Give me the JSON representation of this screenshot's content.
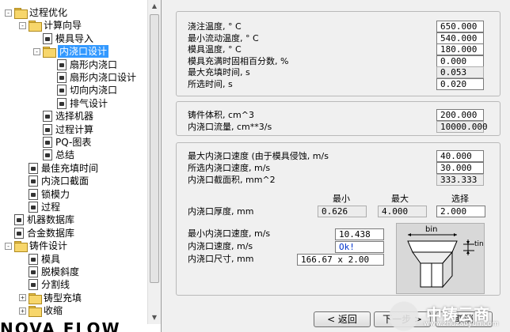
{
  "tree": {
    "items": [
      {
        "label": "过程优化",
        "level": 0,
        "type": "folder",
        "expander": "-"
      },
      {
        "label": "计算向导",
        "level": 1,
        "type": "folder",
        "expander": "-"
      },
      {
        "label": "模具导入",
        "level": 2,
        "type": "doc",
        "expander": ""
      },
      {
        "label": "内浇口设计",
        "level": 2,
        "type": "folder",
        "expander": "-",
        "selected": true
      },
      {
        "label": "扇形内浇口",
        "level": 3,
        "type": "doc",
        "expander": ""
      },
      {
        "label": "扇形内浇口设计",
        "level": 3,
        "type": "doc",
        "expander": ""
      },
      {
        "label": "切向内浇口",
        "level": 3,
        "type": "doc",
        "expander": ""
      },
      {
        "label": "排气设计",
        "level": 3,
        "type": "doc",
        "expander": ""
      },
      {
        "label": "选择机器",
        "level": 2,
        "type": "doc",
        "expander": ""
      },
      {
        "label": "过程计算",
        "level": 2,
        "type": "doc",
        "expander": ""
      },
      {
        "label": "PQ-图表",
        "level": 2,
        "type": "doc",
        "expander": ""
      },
      {
        "label": "总结",
        "level": 2,
        "type": "doc",
        "expander": ""
      },
      {
        "label": "最佳充填时间",
        "level": 1,
        "type": "doc",
        "expander": ""
      },
      {
        "label": "内浇口截面",
        "level": 1,
        "type": "doc",
        "expander": ""
      },
      {
        "label": "锁模力",
        "level": 1,
        "type": "doc",
        "expander": ""
      },
      {
        "label": "过程",
        "level": 1,
        "type": "doc",
        "expander": ""
      },
      {
        "label": "机器数据库",
        "level": 0,
        "type": "doc",
        "expander": ""
      },
      {
        "label": "合金数据库",
        "level": 0,
        "type": "doc",
        "expander": ""
      },
      {
        "label": "铸件设计",
        "level": 0,
        "type": "folder",
        "expander": "-"
      },
      {
        "label": "模具",
        "level": 1,
        "type": "doc",
        "expander": ""
      },
      {
        "label": "脱模斜度",
        "level": 1,
        "type": "doc",
        "expander": ""
      },
      {
        "label": "分割线",
        "level": 1,
        "type": "doc",
        "expander": ""
      },
      {
        "label": "铸型充填",
        "level": 1,
        "type": "folder",
        "expander": "+"
      },
      {
        "label": "收缩",
        "level": 1,
        "type": "folder",
        "expander": "+"
      }
    ],
    "bottom_text": "NOVA FLOW"
  },
  "group1": {
    "rows": [
      {
        "label": "浇注温度, ° C",
        "value": "650.000",
        "readonly": false
      },
      {
        "label": "最小流动温度, ° C",
        "value": "540.000",
        "readonly": false
      },
      {
        "label": "模具温度, ° C",
        "value": "180.000",
        "readonly": false
      },
      {
        "label": "模具充满时固相百分数, %",
        "value": "0.000",
        "readonly": false
      },
      {
        "label": "最大充填时间, s",
        "value": "0.053",
        "readonly": true
      },
      {
        "label": "所选时间, s",
        "value": "0.020",
        "readonly": false
      }
    ]
  },
  "group2": {
    "rows": [
      {
        "label": "铸件体积, cm^3",
        "value": "200.000",
        "readonly": false
      },
      {
        "label": "内浇口流量, cm**3/s",
        "value": "10000.000",
        "readonly": true
      }
    ]
  },
  "group3": {
    "rows": [
      {
        "label": "最大内浇口速度 (由于模具侵蚀, m/s",
        "value": "40.000",
        "readonly": false
      },
      {
        "label": "所选内浇口速度, m/s",
        "value": "30.000",
        "readonly": false
      },
      {
        "label": "内浇口截面积, mm^2",
        "value": "333.333",
        "readonly": true
      }
    ],
    "headers": {
      "min": "最小",
      "max": "最大",
      "select": "选择"
    },
    "thickness": {
      "label": "内浇口厚度, mm",
      "min": "0.626",
      "max": "4.000",
      "select": "2.000"
    },
    "lower": [
      {
        "label": "最小内浇口速度, m/s",
        "value": "10.438"
      },
      {
        "label": "内浇口速度, m/s",
        "value": "Ok!"
      },
      {
        "label": "内浇口尺寸, mm",
        "value": "166.67 x 2.00"
      }
    ],
    "diagram": {
      "bin": "bin",
      "tin": "tin"
    }
  },
  "buttons": {
    "back": "< 返回",
    "next": "下一步 >",
    "cancel": "取消"
  },
  "watermark": {
    "title": "中铸云商",
    "sub": "www.zhuzaoyun.com"
  }
}
